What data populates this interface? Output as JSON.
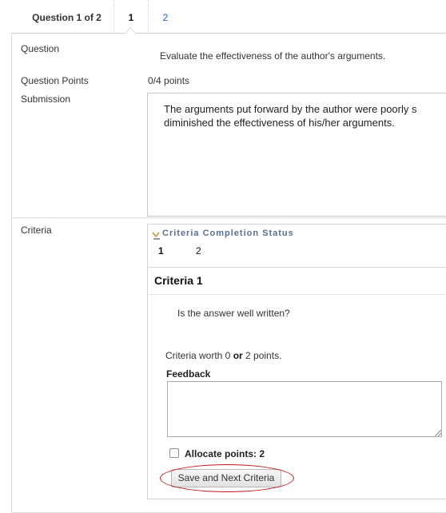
{
  "question_nav": {
    "label": "Question 1 of 2",
    "tabs": [
      "1",
      "2"
    ]
  },
  "question": {
    "label": "Question",
    "text": "Evaluate the effectiveness of the author's arguments."
  },
  "points": {
    "label": "Question Points",
    "value": "0/4 points"
  },
  "submission": {
    "label": "Submission",
    "text": "The arguments put forward by the author were poorly s\ndiminished the effectiveness of his/her arguments."
  },
  "criteria": {
    "label": "Criteria",
    "status_title": "Criteria Completion Status",
    "numbers": [
      "1",
      "2"
    ],
    "current_title": "Criteria 1",
    "prompt": "Is the answer well written?",
    "worth_prefix": "Criteria worth 0 ",
    "worth_or": "or",
    "worth_suffix": " 2 points.",
    "feedback_label": "Feedback",
    "feedback_value": "",
    "allocate_label": "Allocate points: 2",
    "allocate_checked": false,
    "save_button": "Save and Next Criteria"
  },
  "colors": {
    "tab_link": "#2266bb",
    "status_title": "#5a6e99",
    "highlight": "#c2161a"
  }
}
